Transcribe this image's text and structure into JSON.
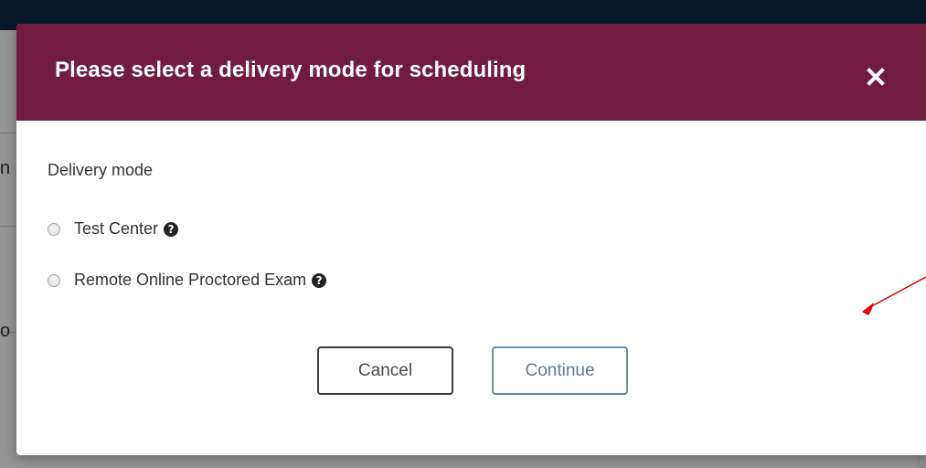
{
  "modal": {
    "title": "Please select a delivery mode for scheduling",
    "close_icon": "close-icon",
    "field_label": "Delivery mode",
    "options": [
      {
        "label": "Test Center",
        "selected": false,
        "help_icon": "question-circle-icon"
      },
      {
        "label": "Remote Online Proctored Exam",
        "selected": false,
        "help_icon": "question-circle-icon"
      }
    ],
    "buttons": {
      "cancel": "Cancel",
      "continue": "Continue"
    }
  },
  "colors": {
    "header_bg": "#721b41",
    "header_text": "#ffffff",
    "top_strip": "#0d2b45",
    "continue_border": "#6f8da4",
    "annotation_arrow": "#e00000"
  }
}
